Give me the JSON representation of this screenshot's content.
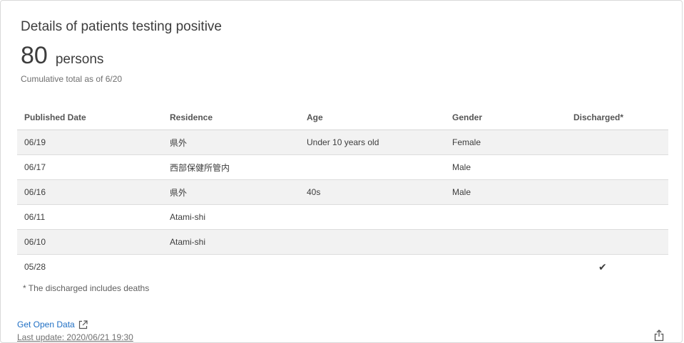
{
  "card": {
    "title": "Details of patients testing positive",
    "total_number": "80",
    "total_unit": "persons",
    "total_note": "Cumulative total as of 6/20"
  },
  "table": {
    "headers": [
      "Published Date",
      "Residence",
      "Age",
      "Gender",
      "Discharged*"
    ],
    "rows": [
      [
        "06/19",
        "県外",
        "Under 10 years old",
        "Female",
        ""
      ],
      [
        "06/17",
        "西部保健所管内",
        "",
        "Male",
        ""
      ],
      [
        "06/16",
        "県外",
        "40s",
        "Male",
        ""
      ],
      [
        "06/11",
        "Atami-shi",
        "",
        "",
        ""
      ],
      [
        "06/10",
        "Atami-shi",
        "",
        "",
        ""
      ],
      [
        "05/28",
        "",
        "",
        "",
        "✔"
      ]
    ]
  },
  "footnote": "* The discharged includes deaths",
  "footer": {
    "open_data_label": "Get Open Data",
    "last_update": "Last update: 2020/06/21 19:30"
  },
  "icons": {
    "external_link": "external-link-icon",
    "share": "share-icon"
  },
  "colors": {
    "link": "#1f6fc4",
    "row_stripe": "#f2f2f2"
  }
}
